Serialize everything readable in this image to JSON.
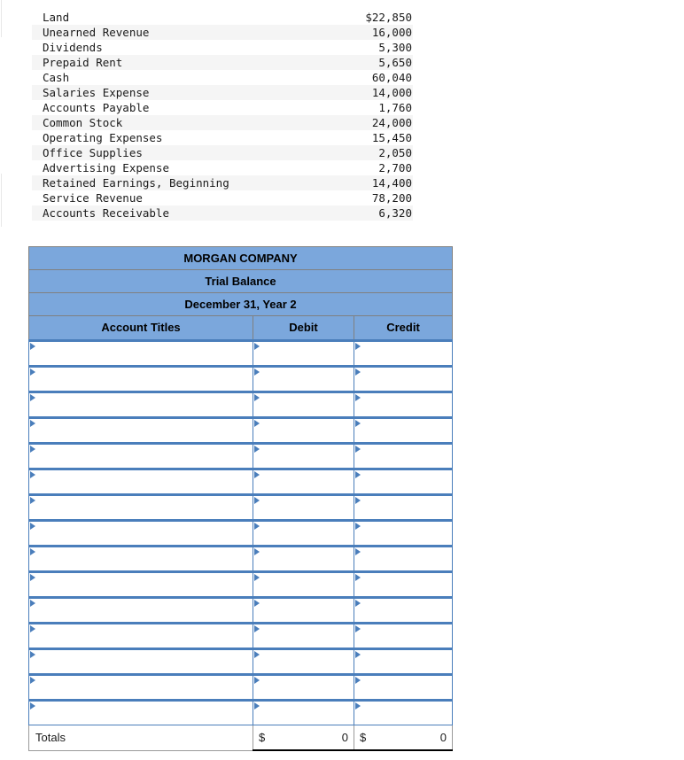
{
  "account_list": {
    "rows": [
      {
        "name": "Land",
        "amount": "$22,850"
      },
      {
        "name": "Unearned Revenue",
        "amount": "16,000"
      },
      {
        "name": "Dividends",
        "amount": "5,300"
      },
      {
        "name": "Prepaid Rent",
        "amount": "5,650"
      },
      {
        "name": "Cash",
        "amount": "60,040"
      },
      {
        "name": "Salaries Expense",
        "amount": "14,000"
      },
      {
        "name": "Accounts Payable",
        "amount": "1,760"
      },
      {
        "name": "Common Stock",
        "amount": "24,000"
      },
      {
        "name": "Operating Expenses",
        "amount": "15,450"
      },
      {
        "name": "Office Supplies",
        "amount": "2,050"
      },
      {
        "name": "Advertising Expense",
        "amount": "2,700"
      },
      {
        "name": "Retained Earnings, Beginning",
        "amount": "14,400"
      },
      {
        "name": "Service Revenue",
        "amount": "78,200"
      },
      {
        "name": "Accounts Receivable",
        "amount": "6,320"
      }
    ]
  },
  "worksheet": {
    "company": "MORGAN COMPANY",
    "statement": "Trial Balance",
    "period": "December 31, Year 2",
    "columns": {
      "accounts": "Account Titles",
      "debit": "Debit",
      "credit": "Credit"
    },
    "entry_row_count": 15,
    "totals": {
      "label": "Totals",
      "debit_symbol": "$",
      "debit_value": "0",
      "credit_symbol": "$",
      "credit_value": "0"
    },
    "colors": {
      "header_fill": "#7BA7DC",
      "entry_border": "#4A7EBB",
      "grid": "#808080"
    }
  }
}
